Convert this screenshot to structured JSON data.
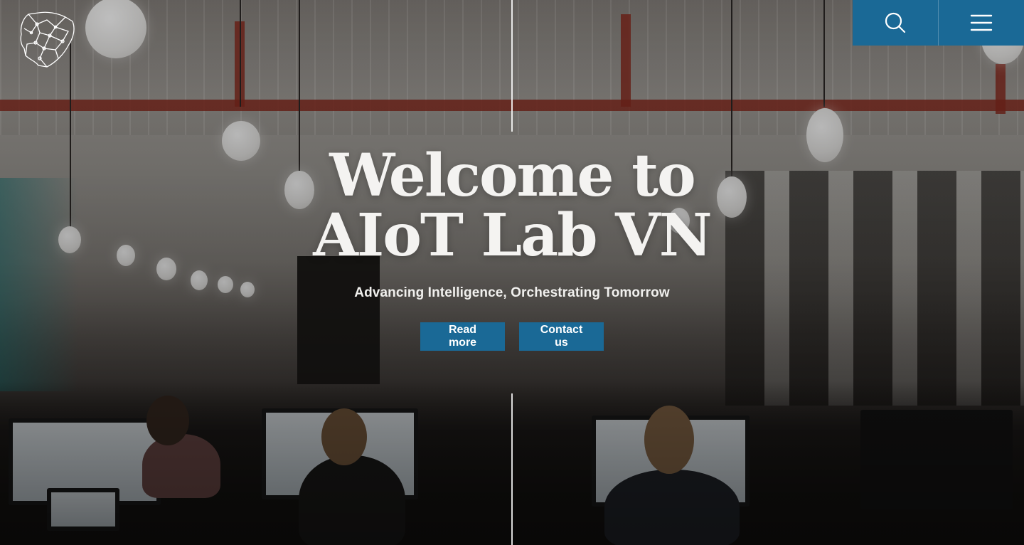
{
  "header": {
    "logo_icon": "brain-circuit-logo",
    "search_icon": "search-icon",
    "menu_icon": "hamburger-menu-icon",
    "accent_color": "#1a6996"
  },
  "hero": {
    "title_line1": "Welcome to",
    "title_line2": "AIoT Lab VN",
    "subtitle": "Advancing Intelligence, Orchestrating Tomorrow",
    "read_more_label": "Read more",
    "contact_label": "Contact us"
  }
}
